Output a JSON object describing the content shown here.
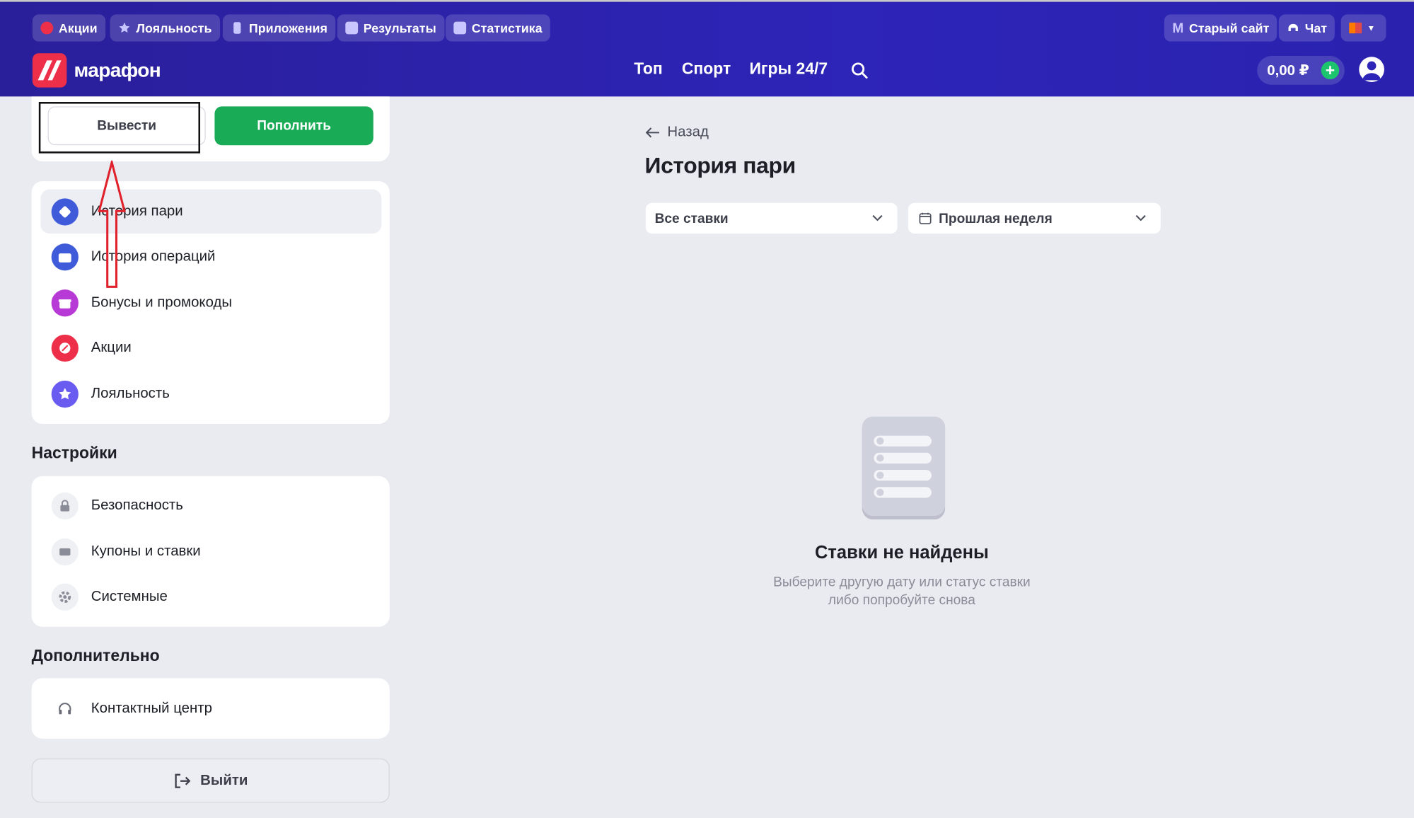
{
  "header": {
    "top_chips": [
      {
        "label": "Акции",
        "icon": "promo-icon"
      },
      {
        "label": "Лояльность",
        "icon": "loyalty-star-icon"
      },
      {
        "label": "Приложения",
        "icon": "phone-icon"
      },
      {
        "label": "Результаты",
        "icon": "results-icon"
      },
      {
        "label": "Статистика",
        "icon": "statistics-icon"
      }
    ],
    "old_site_label": "Старый сайт",
    "old_site_letter": "M",
    "chat_label": "Чат",
    "logo_text": "марафон",
    "nav": [
      "Топ",
      "Спорт",
      "Игры 24/7"
    ],
    "balance": "0,00 ₽",
    "plus_symbol": "+"
  },
  "wallet": {
    "withdraw_label": "Вывести",
    "deposit_label": "Пополнить"
  },
  "menu": [
    {
      "label": "История пари",
      "icon": "bet-history-icon",
      "color": "#3f5bd9",
      "active": true
    },
    {
      "label": "История операций",
      "icon": "wallet-icon",
      "color": "#3f5bd9",
      "active": false
    },
    {
      "label": "Бонусы и промокоды",
      "icon": "gift-icon",
      "color": "#b83ad6",
      "active": false
    },
    {
      "label": "Акции",
      "icon": "promo-icon",
      "color": "#ee2f4a",
      "active": false
    },
    {
      "label": "Лояльность",
      "icon": "loyalty-star-icon",
      "color": "#6a5cf0",
      "active": false
    }
  ],
  "settings": {
    "title": "Настройки",
    "items": [
      {
        "label": "Безопасность",
        "icon": "lock-icon"
      },
      {
        "label": "Купоны и ставки",
        "icon": "coupon-icon"
      },
      {
        "label": "Системные",
        "icon": "gear-icon"
      }
    ]
  },
  "extra": {
    "title": "Дополнительно",
    "items": [
      {
        "label": "Контактный центр",
        "icon": "headset-icon"
      }
    ]
  },
  "logout_label": "Выйти",
  "main": {
    "back_label": "Назад",
    "title": "История пари",
    "filter_type": "Все ставки",
    "filter_period": "Прошлая неделя",
    "empty_title": "Ставки не найдены",
    "empty_line1": "Выберите другую дату или статус ставки",
    "empty_line2": "либо попробуйте снова"
  },
  "colors": {
    "header_bg": "#2d24b8",
    "accent_green": "#1aab57",
    "brand_red": "#ee2f4a",
    "annotation_red": "#e0202a"
  }
}
